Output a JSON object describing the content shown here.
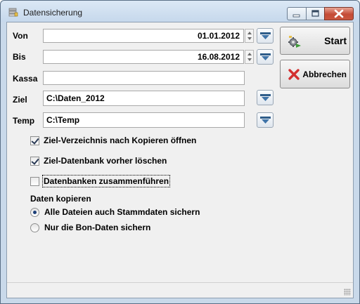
{
  "window": {
    "title": "Datensicherung",
    "icon": "database-backup-icon"
  },
  "form": {
    "von": {
      "label": "Von",
      "value": "01.01.2012"
    },
    "bis": {
      "label": "Bis",
      "value": "16.08.2012"
    },
    "kassa": {
      "label": "Kassa",
      "value": ""
    },
    "ziel": {
      "label": "Ziel",
      "value": "C:\\Daten_2012"
    },
    "temp": {
      "label": "Temp",
      "value": "C:\\Temp"
    }
  },
  "buttons": {
    "start": {
      "label": "Start",
      "icon": "gear-run-icon"
    },
    "abbrechen": {
      "label": "Abbrechen",
      "icon": "red-x-icon"
    },
    "picker_icon": "funnel-dropdown-icon"
  },
  "options": {
    "checkboxes": [
      {
        "label": "Ziel-Verzeichnis nach Kopieren öffnen",
        "checked": true
      },
      {
        "label": "Ziel-Datenbank vorher löschen",
        "checked": true
      },
      {
        "label": "Datenbanken zusammenführen",
        "checked": false
      }
    ],
    "copy_group": {
      "title": "Daten kopieren",
      "radios": [
        {
          "label": "Alle Dateien auch Stammdaten sichern",
          "selected": true
        },
        {
          "label": "Nur die Bon-Daten sichern",
          "selected": false
        }
      ]
    }
  },
  "colors": {
    "titlebar": "#c9d9ea",
    "close_button": "#c44b36",
    "picker_icon": "#2f5d8a",
    "abbrechen_x": "#d32f2f"
  }
}
